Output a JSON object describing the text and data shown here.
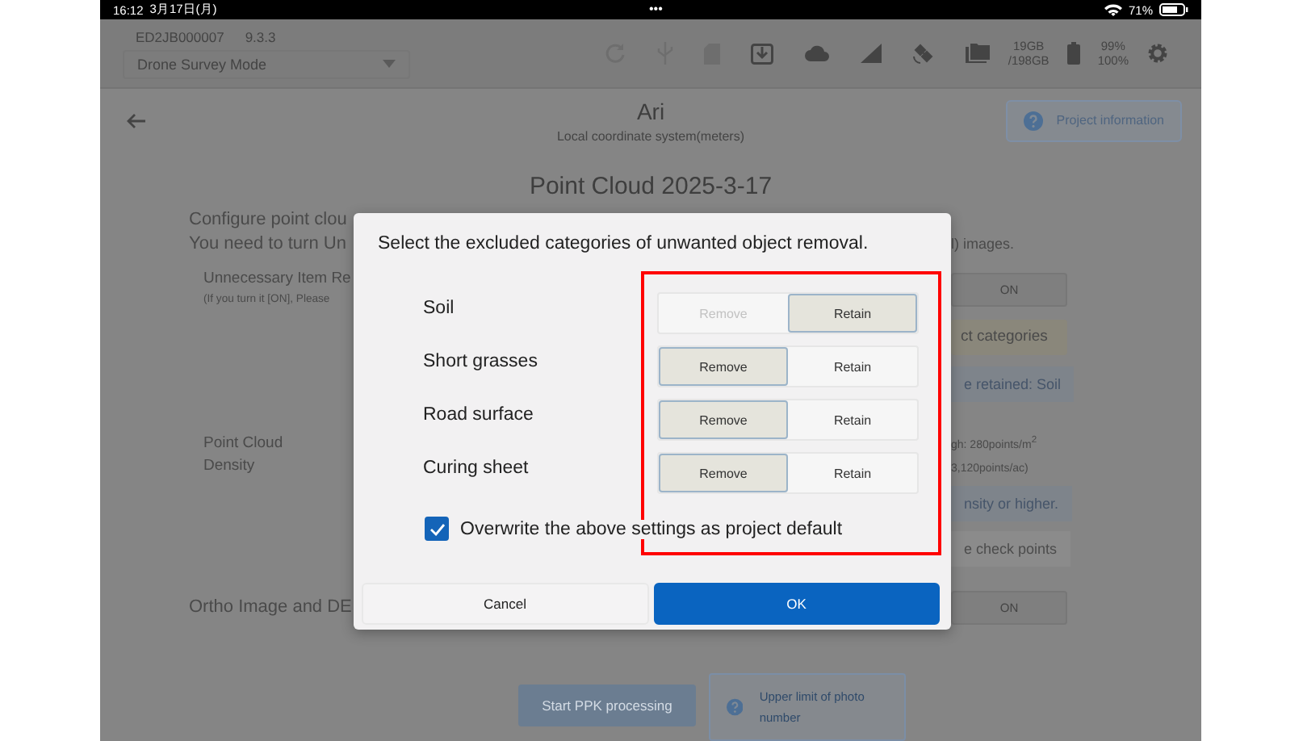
{
  "status_bar": {
    "time": "16:12",
    "date": "3月17日(月)",
    "dots": "•••",
    "battery": "71%"
  },
  "header": {
    "serial": "ED2JB000007",
    "version": "9.3.3",
    "mode_dropdown": {
      "value": "Drone Survey Mode"
    },
    "storage": [
      "19GB",
      "/198GB"
    ],
    "battery": [
      "99%",
      "100%"
    ]
  },
  "title_bar": {
    "title": "Ari",
    "subtitle": "Local coordinate system(meters)",
    "info_button": "Project information"
  },
  "page_title": "Point Cloud 2025-3-17",
  "rows": [
    {
      "label": [
        "Configure point clou"
      ]
    },
    {
      "label": [
        "You need to turn Un"
      ],
      "right": {
        "kind": "text",
        "lines": [
          "l) images."
        ]
      }
    },
    {
      "label": [
        "Unnecessary Item Re"
      ],
      "hint": "(If you turn it [ON], Please",
      "right": {
        "kind": "toggle",
        "lines": [
          "ON"
        ]
      }
    },
    {
      "right": {
        "kind": "button",
        "lines": [
          "ct categories"
        ]
      }
    },
    {
      "right": {
        "kind": "note",
        "lines": [
          "e retained: Soil"
        ]
      }
    },
    {
      "label": [
        "Point Cloud",
        "Density"
      ],
      "right": {
        "kind": "small",
        "lines": [
          "gh: 280points/m$^{2}$",
          "3,120points/ac)"
        ]
      }
    },
    {
      "right": {
        "kind": "note",
        "lines": [
          "nsity or higher."
        ]
      }
    },
    {
      "right": {
        "kind": "disabled-note",
        "lines": [
          "e check points"
        ]
      }
    },
    {
      "label": [
        "Ortho Image and DE"
      ],
      "right": {
        "kind": "toggle",
        "lines": [
          "ON"
        ]
      }
    }
  ],
  "bottom": {
    "ppk_button": "Start PPK processing",
    "photo_limit_button": "Upper limit of photo number"
  },
  "dialog": {
    "title": "Select the excluded categories of unwanted object removal.",
    "categories": [
      {
        "name": "Soil",
        "options": [
          {
            "label": "Remove",
            "selected": false,
            "disabled": true
          },
          {
            "label": "Retain",
            "selected": true,
            "disabled": false
          }
        ]
      },
      {
        "name": "Short grasses",
        "options": [
          {
            "label": "Remove",
            "selected": true,
            "disabled": false
          },
          {
            "label": "Retain",
            "selected": false,
            "disabled": false
          }
        ]
      },
      {
        "name": "Road surface",
        "options": [
          {
            "label": "Remove",
            "selected": true,
            "disabled": false
          },
          {
            "label": "Retain",
            "selected": false,
            "disabled": false
          }
        ]
      },
      {
        "name": "Curing sheet",
        "options": [
          {
            "label": "Remove",
            "selected": true,
            "disabled": false
          },
          {
            "label": "Retain",
            "selected": false,
            "disabled": false
          }
        ]
      }
    ],
    "overwrite_default": {
      "label": "Overwrite the above settings as project default",
      "checked": true
    },
    "buttons": [
      {
        "label": "Cancel",
        "kind": "secondary"
      },
      {
        "label": "OK",
        "kind": "primary"
      }
    ]
  }
}
